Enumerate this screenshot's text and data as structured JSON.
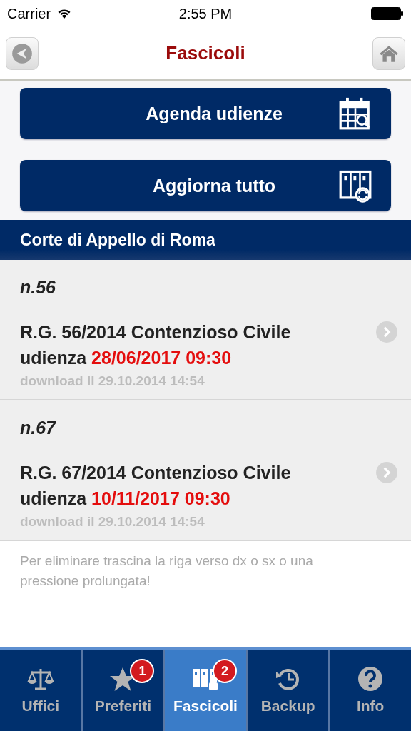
{
  "status_bar": {
    "carrier": "Carrier",
    "time": "2:55 PM"
  },
  "nav": {
    "title": "Fascicoli"
  },
  "actions": [
    {
      "label": "Agenda udienze"
    },
    {
      "label": "Aggiorna tutto"
    }
  ],
  "section": {
    "title": "Corte di Appello di Roma"
  },
  "items": [
    {
      "number": "n.56",
      "case": "R.G. 56/2014 Contenzioso Civile",
      "hearing_label": "udienza",
      "hearing_date": "28/06/2017 09:30",
      "download": "download il 29.10.2014 14:54"
    },
    {
      "number": "n.67",
      "case": "R.G. 67/2014 Contenzioso Civile",
      "hearing_label": "udienza",
      "hearing_date": "10/11/2017 09:30",
      "download": "download il 29.10.2014 14:54"
    }
  ],
  "hint": "Per eliminare trascina la riga verso dx o sx o una pressione prolungata!",
  "tabs": [
    {
      "label": "Uffici",
      "selected": false
    },
    {
      "label": "Preferiti",
      "selected": false,
      "badge": "1"
    },
    {
      "label": "Fascicoli",
      "selected": true,
      "badge": "2"
    },
    {
      "label": "Backup",
      "selected": false
    },
    {
      "label": "Info",
      "selected": false
    }
  ]
}
